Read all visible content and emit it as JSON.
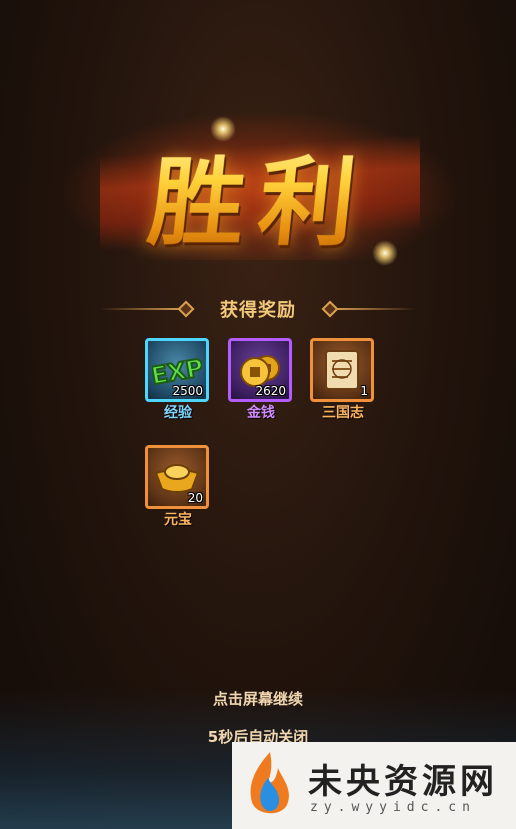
{
  "title": "胜利",
  "rewards_header": "获得奖励",
  "rewards": [
    {
      "name": "经验",
      "count": "2500",
      "icon": "exp-icon",
      "rarity_color": "#4fd6ff",
      "name_color": "#7fd6ff"
    },
    {
      "name": "金钱",
      "count": "2620",
      "icon": "gold-coins-icon",
      "rarity_color": "#b55cff",
      "name_color": "#d28bff"
    },
    {
      "name": "三国志",
      "count": "1",
      "icon": "scroll-book-icon",
      "rarity_color": "#f0903a",
      "name_color": "#ffb460"
    },
    {
      "name": "元宝",
      "count": "20",
      "icon": "gold-ingot-icon",
      "rarity_color": "#f0903a",
      "name_color": "#ffb460"
    }
  ],
  "hints": {
    "tap_continue": "点击屏幕继续",
    "auto_close": "5秒后自动关闭"
  },
  "watermark": {
    "main": "未央资源网",
    "sub": "zy.wyyidc.cn"
  }
}
